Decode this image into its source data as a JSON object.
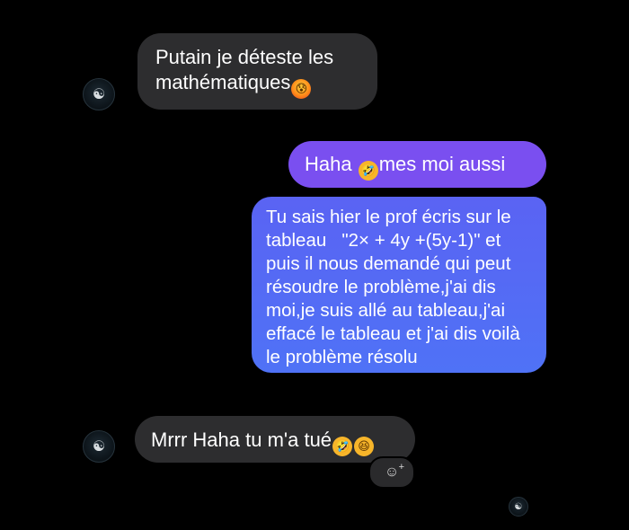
{
  "messages": [
    {
      "sender": "other",
      "text_line1": "Putain je déteste les",
      "text_line2": "mathématiques",
      "emoji": "anxious-face"
    },
    {
      "sender": "me",
      "text_before": "Haha",
      "emoji": "rolling-on-floor-laughing",
      "text_after": "mes moi aussi"
    },
    {
      "sender": "me",
      "lines": [
        "Tu sais hier le prof écris sur le",
        "tableau   \"2× + 4y +(5y-1)\" et",
        "puis il nous demandé qui peut",
        "résoudre le problème,j'ai dis",
        "moi,je suis allé au tableau,j'ai",
        "effacé le tableau et j'ai dis voilà",
        "le problème résolu"
      ]
    },
    {
      "sender": "other",
      "text": "Mrrr Haha tu m'a tué",
      "emojis": [
        "rolling-on-floor-laughing",
        "grinning-squinting-face"
      ]
    }
  ],
  "reaction_button": {
    "icon": "add-reaction-icon",
    "plus": "+"
  },
  "colors": {
    "background": "#000000",
    "incoming_bubble": "#2d2d2f",
    "outgoing_bubble_1": "#7a4ff0",
    "outgoing_bubble_2": "#5a63f3"
  }
}
